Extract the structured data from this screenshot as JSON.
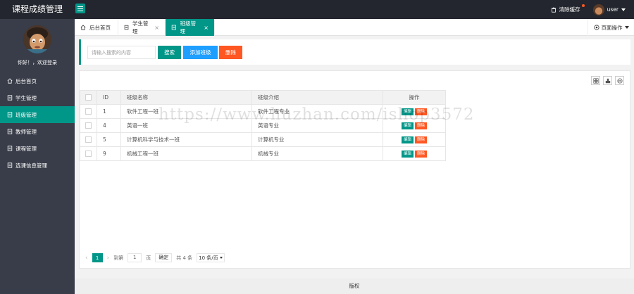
{
  "header": {
    "app_title": "课程成绩管理",
    "clear_cache_label": "清除缓存",
    "user_label": "user"
  },
  "sidebar": {
    "welcome": "你好！，欢迎登录",
    "items": [
      {
        "label": "后台首页",
        "icon": "home-icon"
      },
      {
        "label": "学生管理",
        "icon": "doc-icon"
      },
      {
        "label": "班级管理",
        "icon": "doc-icon"
      },
      {
        "label": "教师管理",
        "icon": "doc-icon"
      },
      {
        "label": "课程管理",
        "icon": "doc-icon"
      },
      {
        "label": "选课信息管理",
        "icon": "doc-icon"
      }
    ]
  },
  "tabs": [
    {
      "label": "后台首页"
    },
    {
      "label": "学生管理"
    },
    {
      "label": "班级管理"
    }
  ],
  "page_ops_label": "页面操作",
  "search": {
    "placeholder": "请输入搜索的内容",
    "search_label": "搜索",
    "add_label": "添加班级",
    "delete_label": "删除"
  },
  "table": {
    "headers": {
      "id": "ID",
      "name": "班级名称",
      "intro": "班级介绍",
      "ops": "操作"
    },
    "edit_label": "编辑",
    "delete_label": "删除",
    "rows": [
      {
        "id": "1",
        "name": "软件工程一班",
        "intro": "软件工程专业"
      },
      {
        "id": "4",
        "name": "英语一班",
        "intro": "英语专业"
      },
      {
        "id": "5",
        "name": "计算机科学与技术一班",
        "intro": "计算机专业"
      },
      {
        "id": "9",
        "name": "机械工程一班",
        "intro": "机械专业"
      }
    ]
  },
  "pager": {
    "current": "1",
    "goto_label": "到第",
    "goto_value": "1",
    "page_label": "页",
    "confirm_label": "确定",
    "total_label": "共 4 条",
    "per_page_label": "10 条/页"
  },
  "footer": {
    "label": "版权"
  },
  "watermark": "https://www.huzhan.com/ishop3572",
  "colors": {
    "accent": "#009688",
    "blue": "#1e9fff",
    "danger": "#ff5722",
    "sidebar": "#393d49",
    "header": "#23262e"
  }
}
